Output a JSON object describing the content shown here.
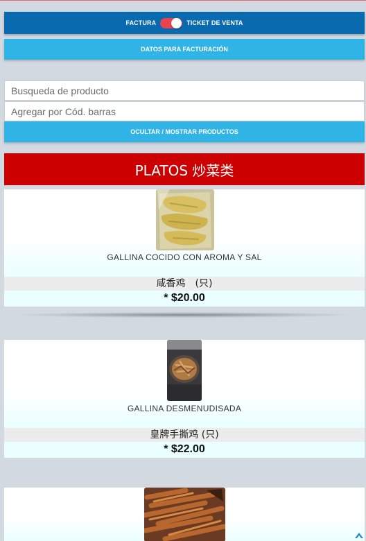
{
  "toggle_bar": {
    "left_label": "FACTURA",
    "right_label": "TICKET DE VENTA",
    "switch_state": "ticket"
  },
  "billing_button": {
    "label": "DATOS PARA FACTURACIÓN"
  },
  "search": {
    "product_placeholder": "Busqueda de producto",
    "barcode_placeholder": "Agregar por Cód. barras"
  },
  "toggle_products_button": {
    "label": "OCULTAR / MOSTRAR PRODUCTOS"
  },
  "category": {
    "title": "PLATOS 炒菜类"
  },
  "products": [
    {
      "name": "GALLINA COCIDO CON AROMA Y SAL",
      "name_cn": "咸香鸡　(只)",
      "price": "* $20.00"
    },
    {
      "name": "GALLINA DESMENUDISADA",
      "name_cn": "皇牌手撕鸡 (只)",
      "price": "* $22.00"
    },
    {
      "name": "",
      "name_cn": "",
      "price": ""
    }
  ],
  "colors": {
    "toggle_bar_bg": "#0a6aaf",
    "light_button_bg": "#30b4e6",
    "category_bg": "#cc0000",
    "switch_bg": "#e8434f",
    "page_bg": "#d3d9e0"
  }
}
